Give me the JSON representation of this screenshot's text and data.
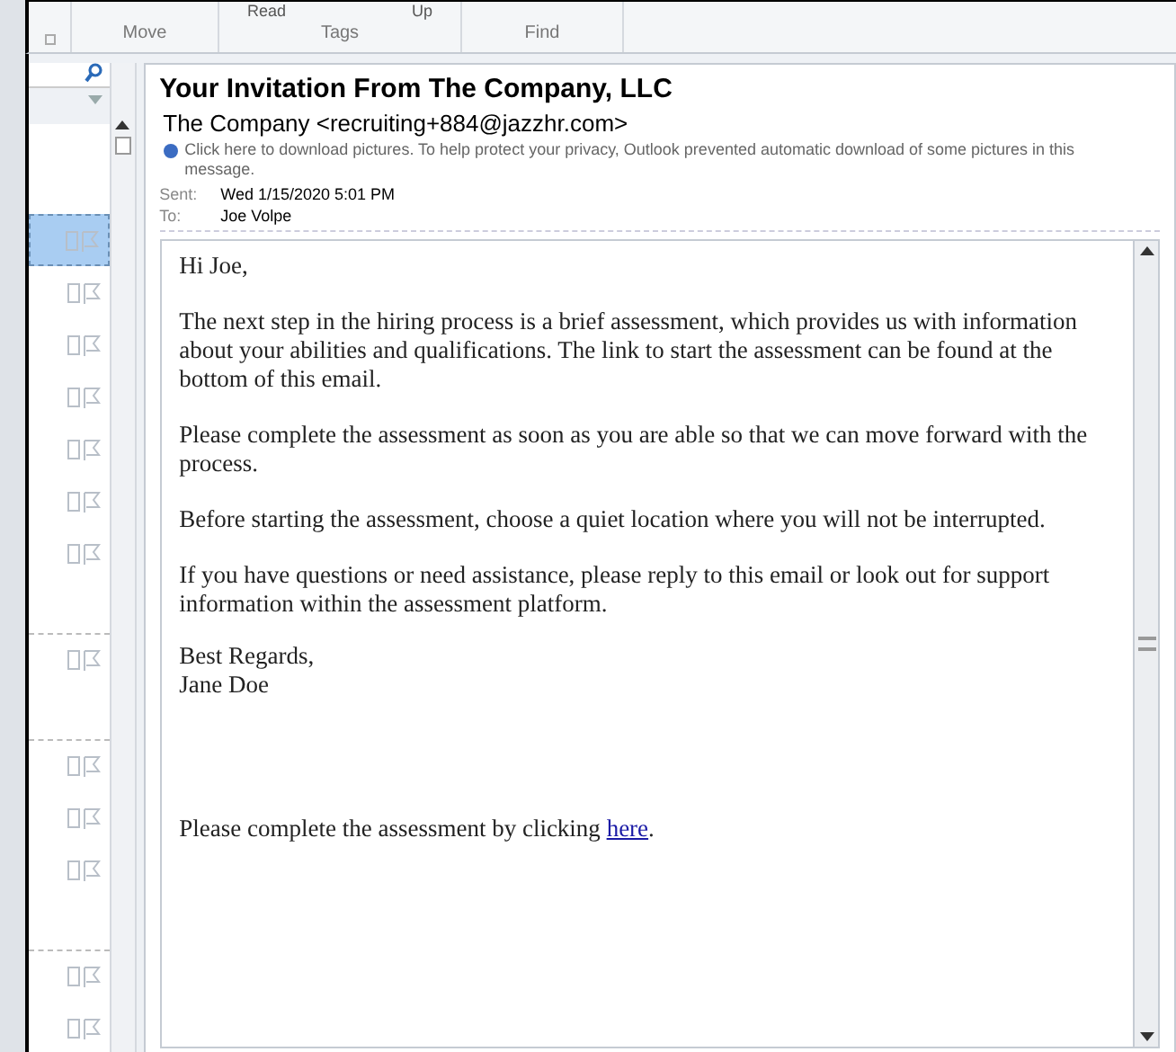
{
  "ribbon": {
    "cut_labels": [
      "Read",
      "Up"
    ],
    "groups": [
      "Move",
      "Tags",
      "Find"
    ]
  },
  "message_list": {
    "rows": [
      {
        "selected": true,
        "group_start": false
      },
      {
        "selected": false,
        "group_start": false
      },
      {
        "selected": false,
        "group_start": false
      },
      {
        "selected": false,
        "group_start": false
      },
      {
        "selected": false,
        "group_start": false
      },
      {
        "selected": false,
        "group_start": false
      },
      {
        "selected": false,
        "group_start": false
      },
      {
        "selected": false,
        "group_start": true
      },
      {
        "selected": false,
        "group_start": true
      },
      {
        "selected": false,
        "group_start": false
      },
      {
        "selected": false,
        "group_start": false
      },
      {
        "selected": false,
        "group_start": true
      },
      {
        "selected": false,
        "group_start": false
      }
    ]
  },
  "message": {
    "subject": "Your Invitation From The Company, LLC",
    "from": "The Company <recruiting+884@jazzhr.com>",
    "info_bar": "Click here to download pictures. To help protect your privacy, Outlook prevented automatic download of some pictures in this message.",
    "fields": [
      {
        "label": "Sent:",
        "value": "Wed 1/15/2020 5:01 PM"
      },
      {
        "label": "To:",
        "value": "Joe Volpe"
      }
    ],
    "body": [
      "Hi Joe,",
      "The next step in the hiring process is a brief assessment, which provides us with information about your abilities and qualifications. The link to start the assessment can be found at the bottom of this email.",
      "Please complete the assessment as soon as you are able so that we can move forward with the process.",
      "Before starting the assessment, choose a quiet location where you will not be interrupted.",
      "If you have questions or need assistance, please reply to this email or look out for support information within the assessment platform."
    ],
    "signature": [
      "Best Regards,",
      "Jane Doe"
    ],
    "closing": {
      "text": "Please complete the assessment by clicking",
      "link": "here",
      "after": "."
    }
  }
}
